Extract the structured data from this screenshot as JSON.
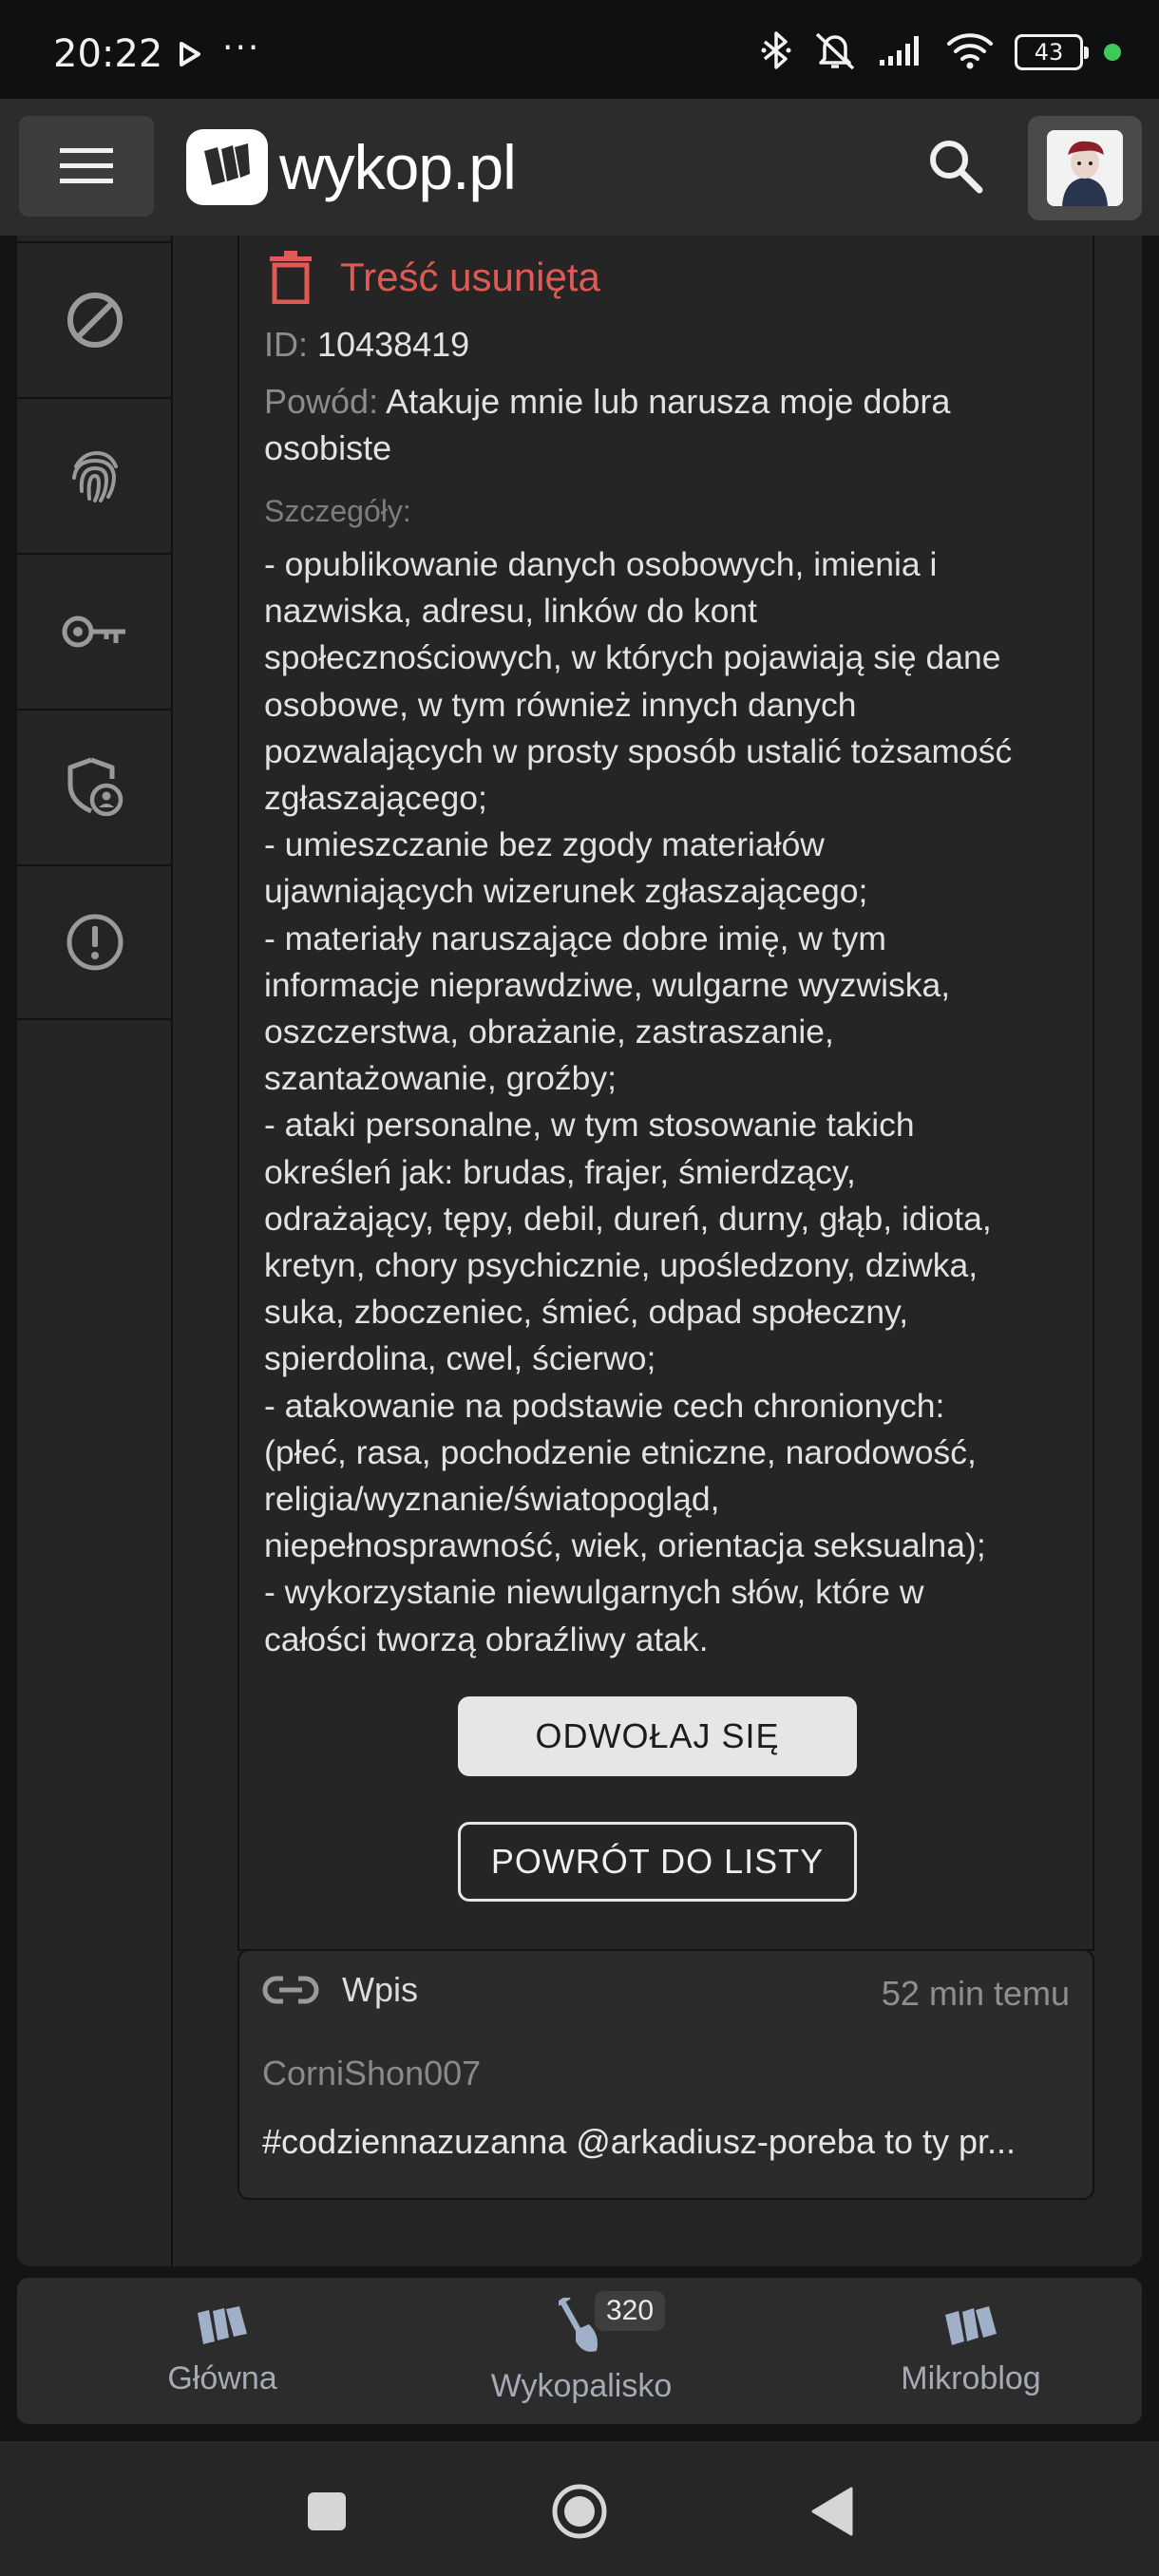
{
  "status_bar": {
    "time": "20:22",
    "dots": "···",
    "battery": "43",
    "icons": [
      "play-icon",
      "bluetooth-icon",
      "mute-icon",
      "signal-icon",
      "wifi-icon",
      "battery-icon"
    ]
  },
  "header": {
    "logo_text": "wykop.pl",
    "icons": [
      "hamburger-menu-icon",
      "search-icon",
      "user-avatar"
    ]
  },
  "sidebar": {
    "items": [
      {
        "icon": "block-icon"
      },
      {
        "icon": "fingerprint-icon"
      },
      {
        "icon": "key-icon"
      },
      {
        "icon": "shield-user-icon"
      },
      {
        "icon": "alert-circle-icon"
      }
    ]
  },
  "moderation": {
    "title": "Treść usunięta",
    "id_label": "ID:",
    "id_value": "10438419",
    "reason_label": "Powód:",
    "reason_line1": "Atakuje mnie lub narusza moje dobra",
    "reason_line2": "osobiste",
    "details_label": "Szczegóły:",
    "details_text": "- opublikowanie danych osobowych, imienia i\nnazwiska, adresu, linków do kont\nspołecznościowych, w których pojawiają się dane\nosobowe, w tym również innych danych\npozwalających w prosty sposób ustalić tożsamość\nzgłaszającego;\n- umieszczanie bez zgody materiałów\nujawniających wizerunek zgłaszającego;\n- materiały naruszające dobre imię, w tym\ninformacje nieprawdziwe, wulgarne wyzwiska,\noszczerstwa, obrażanie, zastraszanie,\nszantażowanie, groźby;\n- ataki personalne, w tym stosowanie takich\nokreśleń jak: brudas, frajer, śmierdzący,\nodrażający, tępy, debil, dureń, durny, głąb, idiota,\nkretyn, chory psychicznie, upośledzony, dziwka,\nsuka, zboczeniec, śmieć, odpad społeczny,\nspierdolina, cwel, ścierwo;\n- atakowanie na podstawie cech chronionych:\n(płeć, rasa, pochodzenie etniczne, narodowość,\nreligia/wyznanie/światopogląd,\nniepełnosprawność, wiek, orientacja seksualna);\n- wykorzystanie niewulgarnych słów, które w\ncałości tworzą obraźliwy atak.",
    "appeal_button": "ODWOŁAJ SIĘ",
    "back_button": "POWRÓT DO LISTY"
  },
  "entry": {
    "type": "Wpis",
    "time": "52 min temu",
    "author": "CorniShon007",
    "text": "#codziennazuzanna @arkadiusz-poreba to ty pr..."
  },
  "bottom_nav": {
    "items": [
      {
        "label": "Główna"
      },
      {
        "label": "Wykopalisko",
        "badge": "320"
      },
      {
        "label": "Mikroblog"
      }
    ]
  },
  "colors": {
    "accent_red": "#e05a55",
    "header_bg": "#2c2c2c",
    "page_bg": "#141414",
    "nav_icon": "#9fb0c8"
  }
}
